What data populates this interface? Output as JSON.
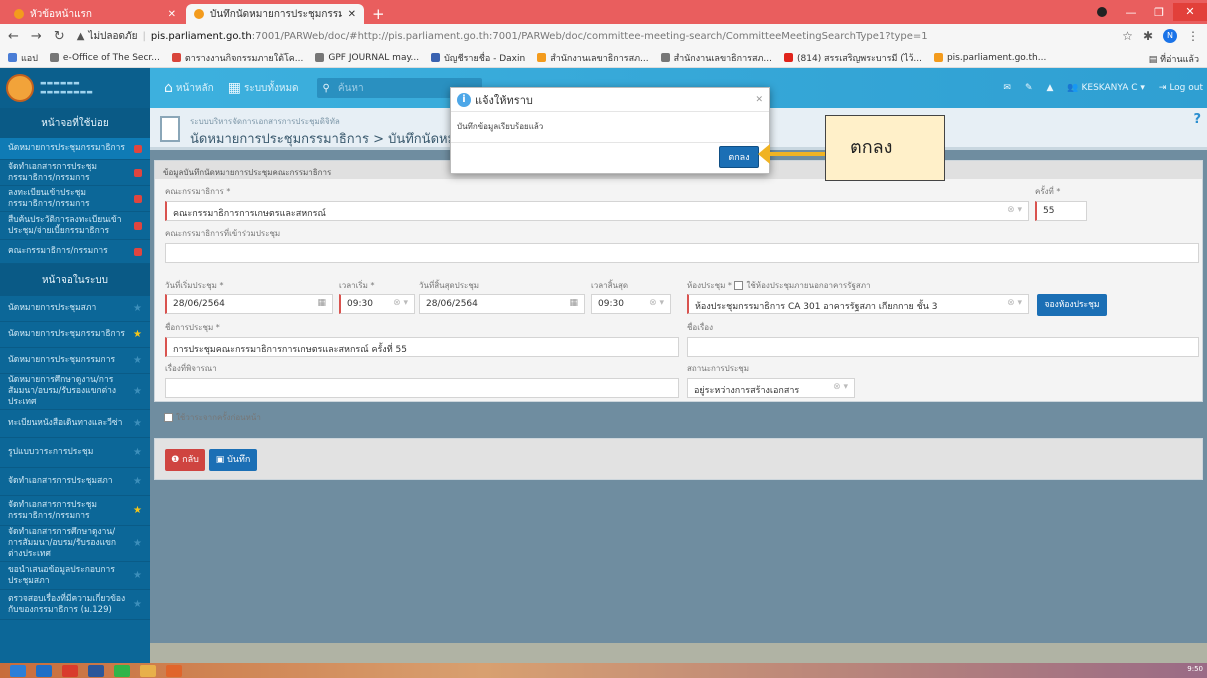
{
  "browser": {
    "tabs": [
      {
        "label": "หัวข้อหน้าแรก",
        "active": false
      },
      {
        "label": "บันทึกนัดหมายการประชุมกรรมาธิการ",
        "active": true
      }
    ],
    "url_warning": "ไม่ปลอดภัย",
    "url_host": "pis.parliament.go.th",
    "url_path": ":7001/PARWeb/doc/#http://pis.parliament.go.th:7001/PARWeb/doc/committee-meeting-search/CommitteeMeetingSearchType1?type=1",
    "profile_initial": "N",
    "bookmarks": [
      {
        "label": "แอป",
        "color": "#4a7dd6"
      },
      {
        "label": "e-Office of The Secr...",
        "color": "#777777"
      },
      {
        "label": "ตารางงานกิจกรรมภายใต้โค...",
        "color": "#d9453b"
      },
      {
        "label": "GPF JOURNAL may...",
        "color": "#777777"
      },
      {
        "label": "บัญชีรายชื่อ - Daxin",
        "color": "#3a62b0"
      },
      {
        "label": "สำนักงานเลขาธิการสภ...",
        "color": "#f39b1d"
      },
      {
        "label": "สำนักงานเลขาธิการสภ...",
        "color": "#777777"
      },
      {
        "label": "(814) สรรเสริญพระบารมี (ไว้...",
        "color": "#e0241b"
      },
      {
        "label": "pis.parliament.go.th...",
        "color": "#f39b1d"
      }
    ],
    "bookmarks_right": "ที่อ่านแล้ว"
  },
  "app_header": {
    "home_label": "หน้าหลัก",
    "modules_label": "ระบบทั้งหมด",
    "search_placeholder": "ค้นหา",
    "user": "KESKANYA C ▾",
    "logout": "Log out"
  },
  "sidebar": {
    "head1": "หน้าจอที่ใช้บ่อย",
    "head2": "หน้าจอในระบบ",
    "items_top": [
      {
        "label": "นัดหมายการประชุมกรรมาธิการ",
        "marker": "red",
        "active": true
      },
      {
        "label": "จัดทำเอกสารการประชุมกรรมาธิการ/กรรมการ",
        "marker": "red",
        "active": false
      },
      {
        "label": "ลงทะเบียนเข้าประชุมกรรมาธิการ/กรรมการ",
        "marker": "red",
        "active": false
      },
      {
        "label": "สืบค้นประวัติการลงทะเบียนเข้าประชุม/จ่ายเบี้ยกรรมาธิการ",
        "marker": "red",
        "active": false
      },
      {
        "label": "คณะกรรมาธิการ/กรรมการ",
        "marker": "red",
        "active": false
      }
    ],
    "items_bottom": [
      {
        "label": "นัดหมายการประชุมสภา",
        "star": "blue"
      },
      {
        "label": "นัดหมายการประชุมกรรมาธิการ",
        "star": "gold"
      },
      {
        "label": "นัดหมายการประชุมกรรมการ",
        "star": "blue"
      },
      {
        "label": "นัดหมายการศึกษาดูงาน/การสัมมนา/อบรม/รับรองแขกต่างประเทศ",
        "star": "blue"
      },
      {
        "label": "ทะเบียนหนังสือเดินทางและวีซ่า",
        "star": "blue"
      },
      {
        "label": "รูปแบบวาระการประชุม",
        "star": "blue"
      },
      {
        "label": "จัดทำเอกสารการประชุมสภา",
        "star": "blue"
      },
      {
        "label": "จัดทำเอกสารการประชุมกรรมาธิการ/กรรมการ",
        "star": "gold"
      },
      {
        "label": "จัดทำเอกสารการศึกษาดูงาน/การสัมมนา/อบรม/รับรองแขกต่างประเทศ",
        "star": "blue"
      },
      {
        "label": "ขอนำเสนอข้อมูลประกอบการประชุมสภา",
        "star": "blue"
      },
      {
        "label": "ตรวจสอบเรื่องที่มีความเกี่ยวข้องกับของกรรมาธิการ (ม.129)",
        "star": "blue"
      }
    ]
  },
  "main": {
    "system_title": "ระบบบริหารจัดการเอกสารการประชุมดิจิทัล",
    "breadcrumb": "นัดหมายการประชุมกรรมาธิการ > บันทึกนัดหมายการประชุม",
    "panel_title": "ข้อมูลบันทึกนัดหมายการประชุมคณะกรรมาธิการ",
    "fields": {
      "committee_label": "คณะกรรมาธิการ *",
      "committee_value": "คณะกรรมาธิการการเกษตรและสหกรณ์",
      "round_label": "ครั้งที่ *",
      "round_value": "55",
      "joint_label": "คณะกรรมาธิการที่เข้าร่วมประชุม",
      "start_date_label": "วันที่เริ่มประชุม *",
      "start_date_value": "28/06/2564",
      "start_time_label": "เวลาเริ่ม *",
      "start_time_value": "09:30",
      "end_date_label": "วันที่สิ้นสุดประชุม",
      "end_date_value": "28/06/2564",
      "end_time_label": "เวลาสิ้นสุด",
      "end_time_value": "09:30",
      "room_label": "ห้องประชุม *",
      "room_checkbox_label": "ใช้ห้องประชุมภายนอกอาคารรัฐสภา",
      "room_value": "ห้องประชุมกรรมาธิการ CA 301 อาคารรัฐสภา เกียกกาย ชั้น 3",
      "book_room_button": "จองห้องประชุม",
      "meeting_name_label": "ชื่อการประชุม *",
      "meeting_name_value": "การประชุมคณะกรรมาธิการการเกษตรและสหกรณ์ ครั้งที่ 55",
      "subject_label": "ชื่อเรื่อง",
      "consider_label": "เรื่องที่พิจารณา",
      "status_label": "สถานะการประชุม",
      "status_value": "อยู่ระหว่างการสร้างเอกสาร",
      "prev_agenda_label": "ใช้วาระจากครั้งก่อนหน้า"
    },
    "back_button": "กลับ",
    "save_button": "บันทึก"
  },
  "modal": {
    "title": "แจ้งให้ทราบ",
    "message": "บันทึกข้อมูลเรียบร้อยแล้ว",
    "ok_button": "ตกลง"
  },
  "callout": {
    "text": "ตกลง"
  },
  "taskbar": {
    "time": "9:50"
  }
}
